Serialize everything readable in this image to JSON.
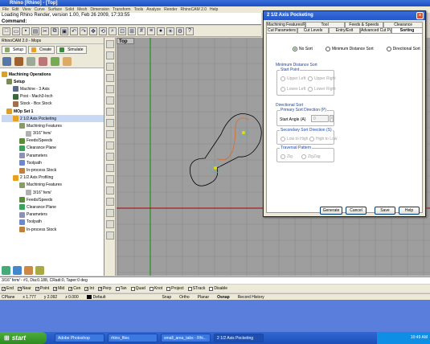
{
  "rhino": {
    "title": "Rhino [Rhino] - [Top]",
    "menu": [
      "File",
      "Edit",
      "View",
      "Curve",
      "Surface",
      "Solid",
      "Mesh",
      "Dimension",
      "Transform",
      "Tools",
      "Analyze",
      "Render",
      "RhinoCAM 2.0",
      "Help"
    ],
    "command_history": "Loading Rhino Render, version 1.00, Feb 26 2009, 17:33:55",
    "command_prompt": "Command:",
    "viewport_label": "Top",
    "status_line": "3/16\" fem/ - #1, Dia:0.188, CRadi:0, Taper:0 deg",
    "osnaps": [
      {
        "label": "End",
        "checked": true
      },
      {
        "label": "Near",
        "checked": true
      },
      {
        "label": "Point",
        "checked": true
      },
      {
        "label": "Mid",
        "checked": true
      },
      {
        "label": "Cen",
        "checked": true
      },
      {
        "label": "Int",
        "checked": true
      },
      {
        "label": "Perp",
        "checked": true
      },
      {
        "label": "Tan",
        "checked": false
      },
      {
        "label": "Quad",
        "checked": false
      },
      {
        "label": "Knot",
        "checked": false
      },
      {
        "label": "Project",
        "checked": false
      },
      {
        "label": "STrack",
        "checked": false
      },
      {
        "label": "Disable",
        "checked": false
      }
    ],
    "status_bar": {
      "cplane": "CPlane",
      "x": "x 1.777",
      "y": "y 2.092",
      "z": "z 0.000",
      "layer": "Default",
      "snap": "Snap",
      "ortho": "Ortho",
      "planar": "Planar",
      "osnap": "Osnap",
      "record": "Record History"
    }
  },
  "left_panel": {
    "title": "RhinoCAM 2.0 - Mops",
    "tabs": [
      "Setup",
      "Create",
      "Simulate"
    ],
    "tree": [
      {
        "label": "Machining Operations",
        "bold": true
      },
      {
        "label": "Setup",
        "bold": true
      },
      {
        "label": "Machine - 3 Axis",
        "bold": false
      },
      {
        "label": "Post - Mach3-Inch",
        "bold": false
      },
      {
        "label": "Stock - Box Stock",
        "bold": false
      },
      {
        "label": "MOp Set 1",
        "bold": true
      },
      {
        "label": "2 1/2 Axis Pocketing",
        "bold": false
      },
      {
        "label": "Machining Features",
        "bold": false
      },
      {
        "label": "3/16\" fem/",
        "bold": false
      },
      {
        "label": "Feeds/Speeds",
        "bold": false
      },
      {
        "label": "Clearance Plane",
        "bold": false
      },
      {
        "label": "Parameters",
        "bold": false
      },
      {
        "label": "Toolpath",
        "bold": false
      },
      {
        "label": "In-process Stock",
        "bold": false
      },
      {
        "label": "2 1/2 Axis Profiling",
        "bold": false
      },
      {
        "label": "Machining Features",
        "bold": false
      },
      {
        "label": "3/16\" fem/",
        "bold": false
      },
      {
        "label": "Feeds/Speeds",
        "bold": false
      },
      {
        "label": "Clearance Plane",
        "bold": false
      },
      {
        "label": "Parameters",
        "bold": false
      },
      {
        "label": "Toolpath",
        "bold": false
      },
      {
        "label": "In-process Stock",
        "bold": false
      }
    ]
  },
  "dialog": {
    "title": "2 1/2 Axis Pocketing",
    "tabs_row1": [
      "Machining Features/Regions",
      "Tool",
      "Feeds & Speeds",
      "Clearance"
    ],
    "tabs_row2": [
      "Cut Parameters",
      "Cut Levels",
      "Entry/Exit",
      "Advanced Cut Parameters",
      "Sorting"
    ],
    "active_tab": "Sorting",
    "sort_options": [
      "No Sort",
      "Minimum Distance Sort",
      "Directional Sort"
    ],
    "min_distance_sort": {
      "title": "Minimum Distance Sort",
      "start_point": "Start Point",
      "options": [
        "Upper Left",
        "Upper Right",
        "Lower Left",
        "Lower Right"
      ]
    },
    "directional_sort": {
      "title": "Directional Sort",
      "primary_title": "Primary Sort Direction (P)",
      "start_angle_label": "Start Angle (A)",
      "start_angle_value": "0",
      "secondary_title": "Secondary Sort Direction (S)",
      "secondary_options": [
        "Low to High",
        "High to Low"
      ],
      "traversal_title": "Traversal Pattern",
      "traversal_options": [
        "Zig",
        "ZigZag"
      ]
    },
    "buttons": [
      "Generate",
      "Cancel",
      "Save",
      "Help"
    ]
  },
  "taskbar": {
    "start": "start",
    "tasks": [
      "Adobe Photoshop",
      "rhino_files",
      "small_area_tabs - Rhi...",
      "2 1/2 Axis Pocketing"
    ],
    "clock": "10:49 AM"
  }
}
